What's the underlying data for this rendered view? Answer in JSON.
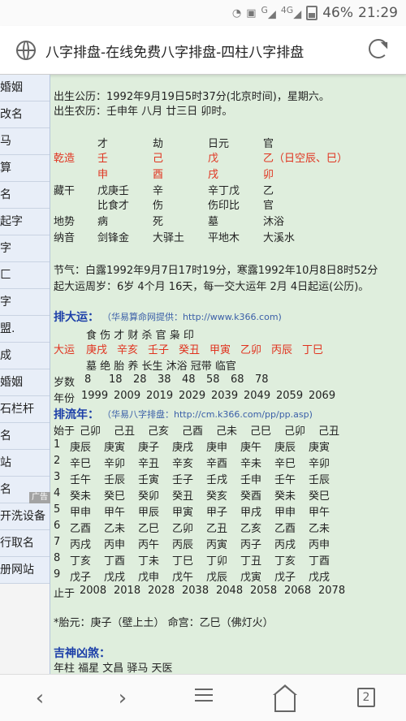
{
  "status_bar": {
    "icons": [
      "wifi-icon",
      "notification-1-icon",
      "signal-g-icon",
      "signal-4g-icon",
      "battery-icon"
    ],
    "g_label": "G",
    "lte_label": "4G",
    "battery": "46%",
    "time": "21:29"
  },
  "browser": {
    "title": "八字排盘-在线免费八字排盘-四柱八字排盘"
  },
  "sidebar": {
    "items": [
      "婚姻",
      "改名",
      "马",
      "算",
      "名",
      "起字",
      "字",
      "匚",
      "字",
      "盟.",
      "成",
      "婚姻",
      " 石栏杆",
      "名",
      "站",
      "名",
      "开洗设备",
      "行取名",
      "册网站"
    ],
    "ad": "广告"
  },
  "content": {
    "solar": "出生公历：1992年9月19日5时37分(北京时间)，星期六。",
    "lunar": "出生农历：壬申年 八月 廿三日 卯时。",
    "gods_row": [
      "才",
      "劫",
      "日元",
      "官"
    ],
    "qianzao_label": "乾造",
    "stems": [
      "壬",
      "己",
      "戊",
      "乙（日空辰、巳）"
    ],
    "branches": [
      "申",
      "酉",
      "戌",
      "卯"
    ],
    "canggan_label": "藏干",
    "canggan": [
      "戊庚壬",
      "辛",
      "辛丁戊",
      "乙"
    ],
    "canggan_gods": [
      "比食才",
      "伤",
      "伤印比",
      "官"
    ],
    "dishi_label": "地势",
    "dishi": [
      "病",
      "死",
      "墓",
      "沐浴"
    ],
    "nayin_label": "纳音",
    "nayin": [
      "剑锋金",
      "大驿土",
      "平地木",
      "大溪水"
    ],
    "jieqi": "节气：白露1992年9月7日17时19分，寒露1992年10月8日8时52分",
    "qiyun": "起大运周岁：6岁 4个月 16天，每一交大运年 2月 4日起运(公历)。",
    "dayun_title": "排大运：",
    "dayun_src": "（华易算命网提供：http://www.k366.com)",
    "dayun_gods": "食  伤  才  财  杀  官  枭  印",
    "dayun_label": "大运",
    "dayun_items": [
      "庚戌",
      "辛亥",
      "壬子",
      "癸丑",
      "甲寅",
      "乙卯",
      "丙辰",
      "丁巳"
    ],
    "dayun_stage": "墓   绝   胎   养   长生  沐浴  冠带  临官",
    "suishu_label": "岁数",
    "suishu": [
      "8",
      "18",
      "28",
      "38",
      "48",
      "58",
      "68",
      "78"
    ],
    "nianfen_label": "年份",
    "nianfen": [
      "1999",
      "2009",
      "2019",
      "2029",
      "2039",
      "2049",
      "2059",
      "2069"
    ],
    "liunian_title": "排流年：",
    "liunian_src": "（华易八字排盘：http://cm.k366.com/pp/pp.asp)",
    "shiyu_label": "始于",
    "shiyu": [
      "己卯",
      "己丑",
      "己亥",
      "己酉",
      "己未",
      "己巳",
      "己卯",
      "己丑"
    ],
    "liunian_rows": [
      {
        "n": "1",
        "items": [
          "庚辰",
          "庚寅",
          "庚子",
          "庚戌",
          "庚申",
          "庚午",
          "庚辰",
          "庚寅"
        ]
      },
      {
        "n": "2",
        "items": [
          "辛巳",
          "辛卯",
          "辛丑",
          "辛亥",
          "辛酉",
          "辛未",
          "辛巳",
          "辛卯"
        ]
      },
      {
        "n": "3",
        "items": [
          "壬午",
          "壬辰",
          "壬寅",
          "壬子",
          "壬戌",
          "壬申",
          "壬午",
          "壬辰"
        ]
      },
      {
        "n": "4",
        "items": [
          "癸未",
          "癸巳",
          "癸卯",
          "癸丑",
          "癸亥",
          "癸酉",
          "癸未",
          "癸巳"
        ]
      },
      {
        "n": "5",
        "items": [
          "甲申",
          "甲午",
          "甲辰",
          "甲寅",
          "甲子",
          "甲戌",
          "甲申",
          "甲午"
        ]
      },
      {
        "n": "6",
        "items": [
          "乙酉",
          "乙未",
          "乙巳",
          "乙卯",
          "乙丑",
          "乙亥",
          "乙酉",
          "乙未"
        ]
      },
      {
        "n": "7",
        "items": [
          "丙戌",
          "丙申",
          "丙午",
          "丙辰",
          "丙寅",
          "丙子",
          "丙戌",
          "丙申"
        ]
      },
      {
        "n": "8",
        "items": [
          "丁亥",
          "丁酉",
          "丁未",
          "丁巳",
          "丁卯",
          "丁丑",
          "丁亥",
          "丁酉"
        ]
      },
      {
        "n": "9",
        "items": [
          "戊子",
          "戊戌",
          "戊申",
          "戊午",
          "戊辰",
          "戊寅",
          "戊子",
          "戊戌"
        ]
      }
    ],
    "zhiyu_label": "止于",
    "zhiyu": [
      "2008",
      "2018",
      "2028",
      "2038",
      "2048",
      "2058",
      "2068",
      "2078"
    ],
    "taiyuan": "*胎元：庚子（壁上土）    命宫：乙巳（佛灯火）",
    "shensha_title": "吉神凶煞：",
    "shensha": "年柱 福星 文昌 驿马 天医"
  },
  "navbar": {
    "back": "‹",
    "forward": "›",
    "tabs_count": "2"
  }
}
